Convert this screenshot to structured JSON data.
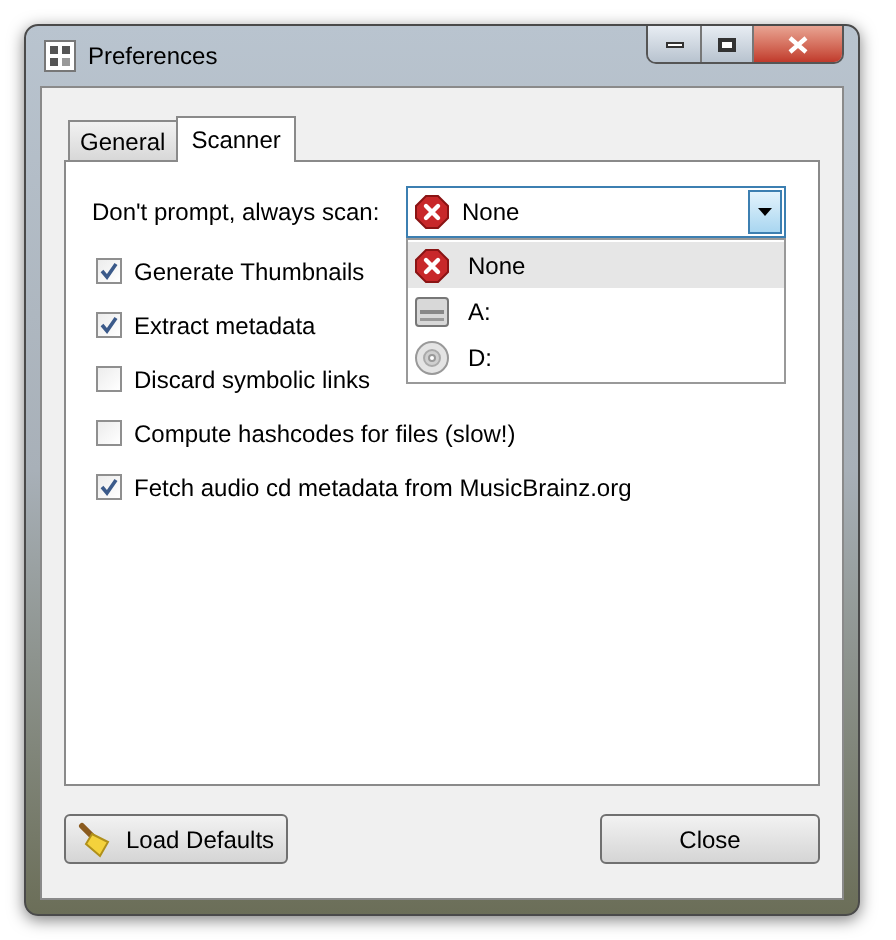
{
  "window": {
    "title": "Preferences"
  },
  "tabs": [
    {
      "label": "General",
      "selected": false
    },
    {
      "label": "Scanner",
      "selected": true
    }
  ],
  "scan_option": {
    "label": "Don't prompt, always scan:",
    "value": {
      "label": "None",
      "kind": "none"
    },
    "expanded": true,
    "options": [
      {
        "label": "None",
        "kind": "none",
        "selected": true
      },
      {
        "label": "A:",
        "kind": "floppy",
        "selected": false
      },
      {
        "label": "D:",
        "kind": "cd",
        "selected": false
      }
    ]
  },
  "checkboxes": [
    {
      "label": "Generate Thumbnails",
      "checked": true
    },
    {
      "label": "Extract metadata",
      "checked": true
    },
    {
      "label": "Discard symbolic links",
      "checked": false
    },
    {
      "label": "Compute hashcodes for files (slow!)",
      "checked": false
    },
    {
      "label": "Fetch audio cd metadata from MusicBrainz.org",
      "checked": true
    }
  ],
  "buttons": [
    {
      "label": "Load Defaults",
      "kind": "defaults"
    },
    {
      "label": "Close",
      "kind": "close"
    }
  ]
}
